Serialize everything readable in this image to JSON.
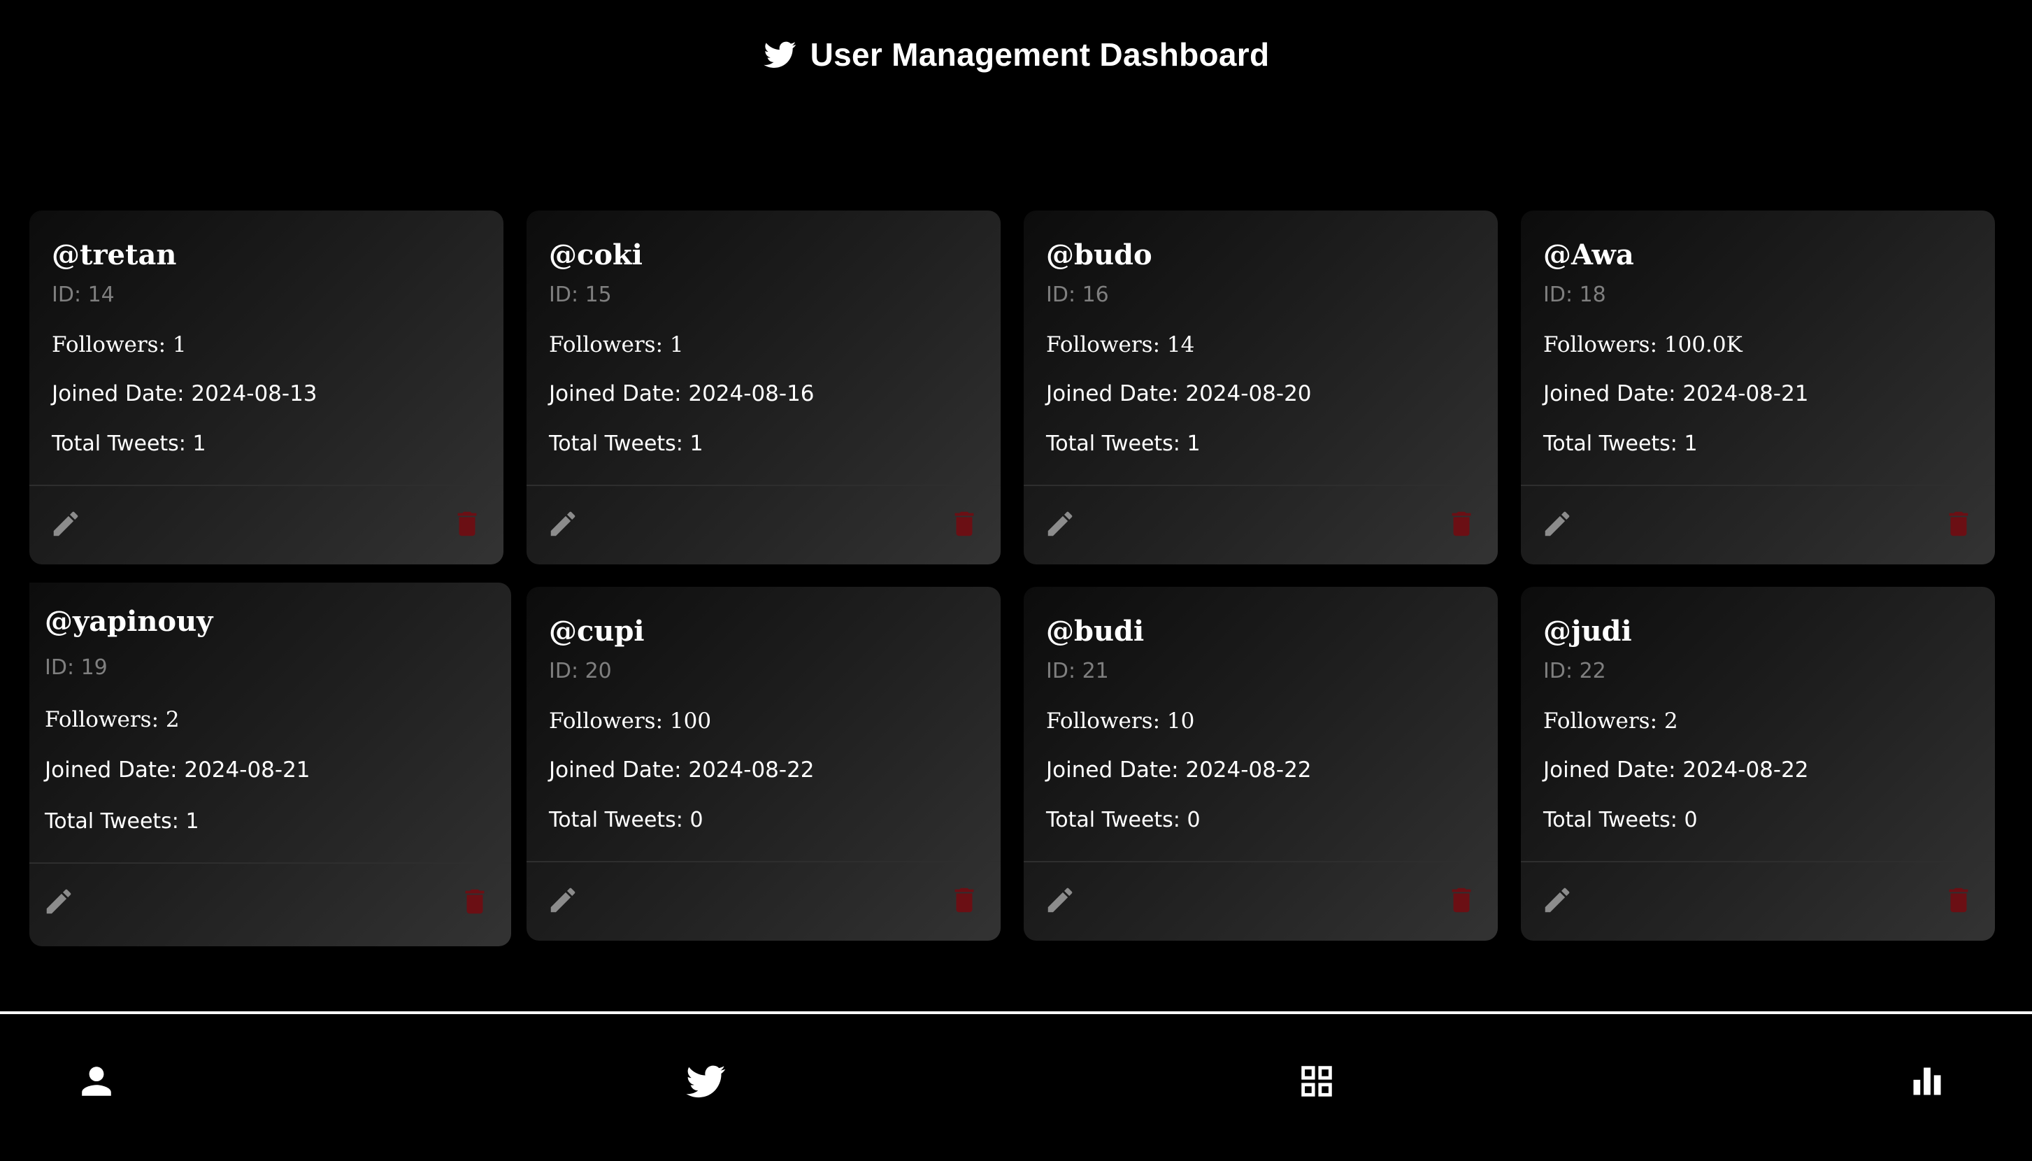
{
  "header": {
    "title": "User Management Dashboard",
    "icon": "twitter-bird-icon"
  },
  "users": [
    {
      "username": "@tretan",
      "id": "ID: 14",
      "followers": "Followers: 1",
      "joined": "Joined Date: 2024-08-13",
      "tweets": "Total Tweets: 1"
    },
    {
      "username": "@coki",
      "id": "ID: 15",
      "followers": "Followers: 1",
      "joined": "Joined Date: 2024-08-16",
      "tweets": "Total Tweets: 1"
    },
    {
      "username": "@budo",
      "id": "ID: 16",
      "followers": "Followers: 14",
      "joined": "Joined Date: 2024-08-20",
      "tweets": "Total Tweets: 1"
    },
    {
      "username": "@Awa",
      "id": "ID: 18",
      "followers": "Followers: 100.0K",
      "joined": "Joined Date: 2024-08-21",
      "tweets": "Total Tweets: 1"
    },
    {
      "username": "@yapinouy",
      "id": "ID: 19",
      "followers": "Followers: 2",
      "joined": "Joined Date: 2024-08-21",
      "tweets": "Total Tweets: 1"
    },
    {
      "username": "@cupi",
      "id": "ID: 20",
      "followers": "Followers: 100",
      "joined": "Joined Date: 2024-08-22",
      "tweets": "Total Tweets: 0"
    },
    {
      "username": "@budi",
      "id": "ID: 21",
      "followers": "Followers: 10",
      "joined": "Joined Date: 2024-08-22",
      "tweets": "Total Tweets: 0"
    },
    {
      "username": "@judi",
      "id": "ID: 22",
      "followers": "Followers: 2",
      "joined": "Joined Date: 2024-08-22",
      "tweets": "Total Tweets: 0"
    }
  ],
  "card_actions": {
    "edit_icon": "pencil-icon",
    "delete_icon": "trash-icon"
  },
  "bottom_nav": {
    "items": [
      "person-icon",
      "twitter-bird-icon",
      "grid-icon",
      "bar-chart-icon"
    ]
  },
  "colors": {
    "background": "#000000",
    "card_gradient_start": "#0c0c0c",
    "card_gradient_end": "#333333",
    "text": "#ffffff",
    "muted": "#7f7f7f",
    "edit_icon": "#8c8c8c",
    "delete_icon": "#6b0f14"
  }
}
